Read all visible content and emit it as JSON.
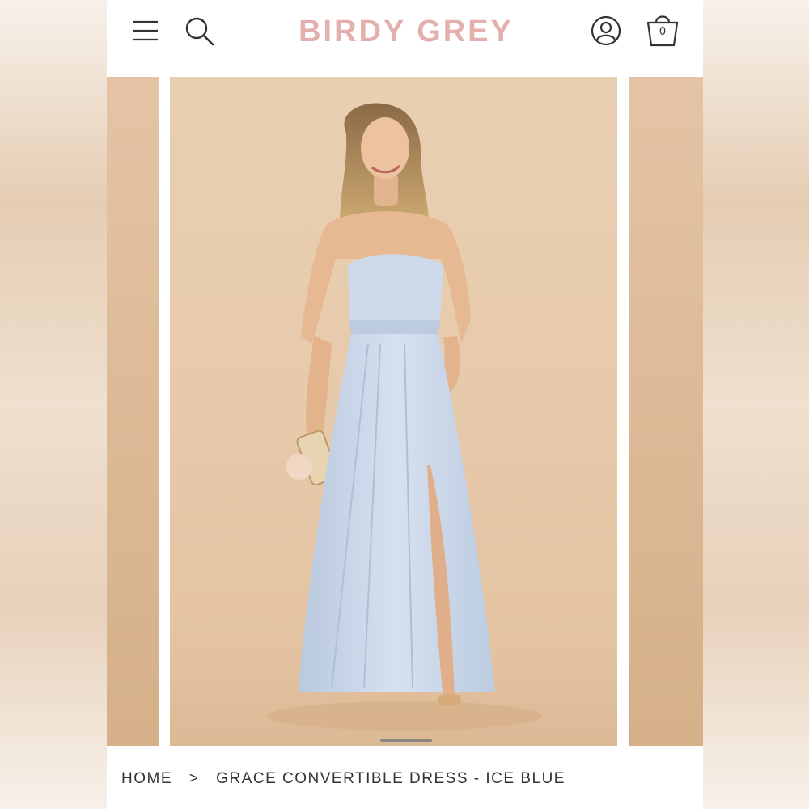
{
  "header": {
    "brand": "BIRDY GREY",
    "cart_count": "0",
    "icons": [
      "menu-icon",
      "search-icon",
      "account-icon",
      "cart-icon"
    ]
  },
  "carousel": {
    "current_slide": 1,
    "image_description_colors": {
      "backdrop": "#e7caab",
      "dress": "#c9d6ea"
    }
  },
  "breadcrumb": {
    "home": "HOME",
    "separator": ">",
    "current": "GRACE CONVERTIBLE DRESS - ICE BLUE"
  },
  "colors": {
    "brand": "#e3b0ad",
    "text": "#333333",
    "background": "#ffffff"
  }
}
